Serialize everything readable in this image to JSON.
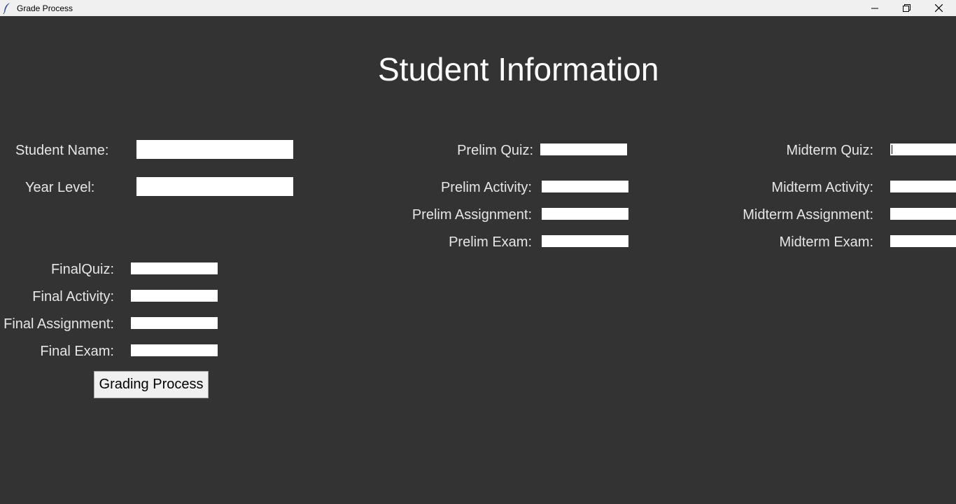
{
  "window": {
    "title": "Grade Process",
    "controls": {
      "minimize_icon": "minimize-icon",
      "restore_icon": "restore-icon",
      "close_icon": "close-icon"
    }
  },
  "heading": "Student Information",
  "student": {
    "name_label": "Student Name:",
    "name_value": "",
    "year_label": "Year Level:",
    "year_value": ""
  },
  "prelim": {
    "quiz_label": "Prelim Quiz:",
    "activity_label": "Prelim Activity:",
    "assignment_label": "Prelim Assignment:",
    "exam_label": "Prelim Exam:"
  },
  "midterm": {
    "quiz_label": "Midterm Quiz:",
    "activity_label": "Midterm Activity:",
    "assignment_label": "Midterm Assignment:",
    "exam_label": "Midterm Exam:"
  },
  "final": {
    "quiz_label": "FinalQuiz:",
    "activity_label": "Final Activity:",
    "assignment_label": "Final Assignment:",
    "exam_label": "Final Exam:"
  },
  "button_label": "Grading Process",
  "colors": {
    "background": "#333333",
    "label": "#e6e6e6",
    "field": "#ffffff",
    "titlebar": "#f0f0f0"
  }
}
